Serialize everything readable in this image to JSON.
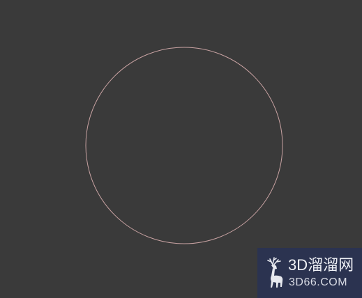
{
  "viewport": {
    "background_color": "#3a3a3a",
    "shape": {
      "type": "circle",
      "stroke_color": "#c9a3a3"
    }
  },
  "watermark": {
    "title": "3D溜溜网",
    "url": "3D66.COM",
    "logo_icon": "deer-icon",
    "background_color": "#2b3350"
  }
}
